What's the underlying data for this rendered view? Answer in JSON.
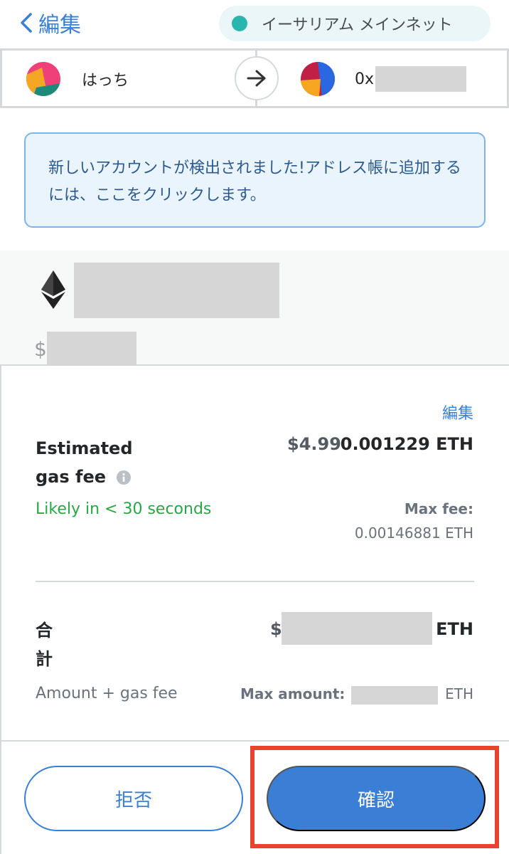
{
  "header": {
    "back_label": "編集",
    "network_label": "イーサリアム メインネット",
    "network_color": "#29b6af"
  },
  "accounts": {
    "from_name": "はっち",
    "to_prefix": "0x"
  },
  "notice": {
    "text": "新しいアカウントが検出されました!アドレス帳に追加するには、ここをクリックします。"
  },
  "amount": {
    "fiat_symbol": "$"
  },
  "gas": {
    "edit_label": "編集",
    "title": "Estimated gas fee",
    "fiat": "$4.99",
    "eth": "0.001229 ETH",
    "likely": "Likely in < 30 seconds",
    "max_fee_label": "Max fee:",
    "max_fee_value": "0.00146881 ETH"
  },
  "total": {
    "title": "合計",
    "fiat_symbol": "$",
    "eth_unit": "ETH",
    "subtitle": "Amount + gas fee",
    "max_amount_label": "Max amount:",
    "max_amount_unit": "ETH"
  },
  "footer": {
    "reject_label": "拒否",
    "confirm_label": "確認"
  },
  "colors": {
    "accent": "#3a80d4",
    "success": "#28a745",
    "highlight": "#e8432f"
  }
}
